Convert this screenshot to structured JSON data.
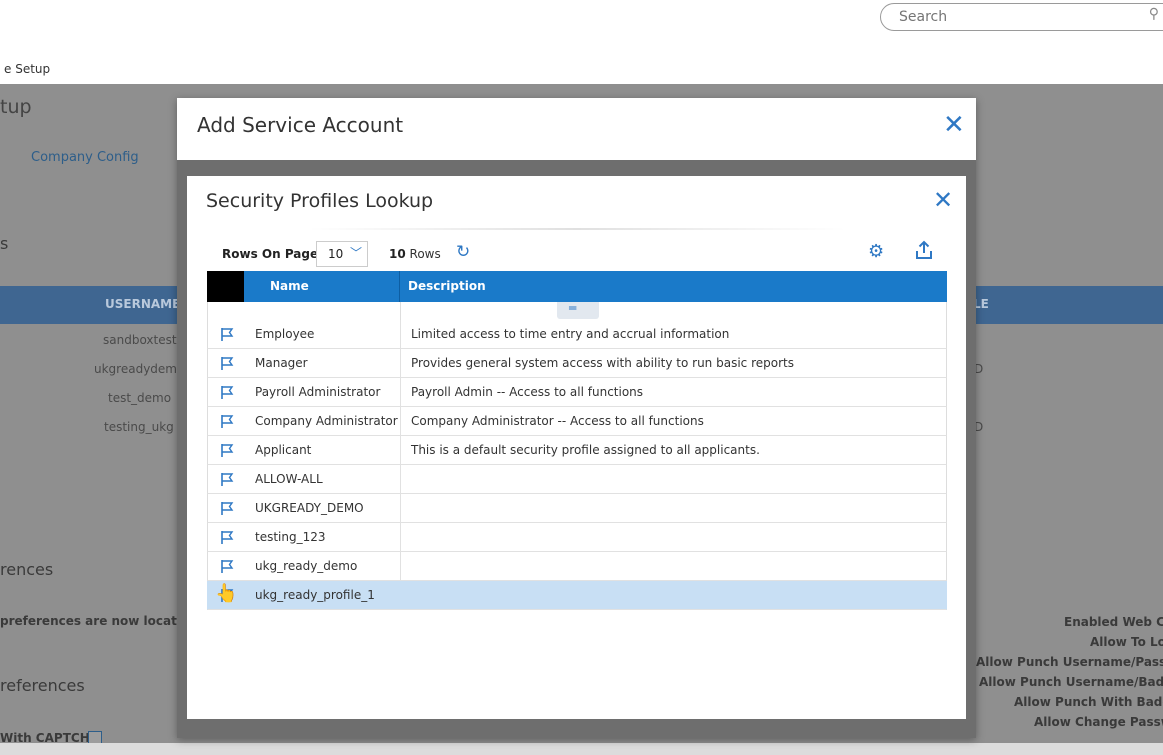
{
  "topbar": {
    "search_placeholder": "Search",
    "search_icon": "magnifier-icon",
    "breadcrumb": "e Setup"
  },
  "background": {
    "page_title": "tup",
    "tab_company_config": "Company Config",
    "section_s": "s",
    "table_header_username": "USERNAME",
    "table_header_right": "LE",
    "usernames": [
      "sandboxtest",
      "ukgreadydemo",
      "test_demo",
      "testing_ukg"
    ],
    "right_fragment_1": "D",
    "right_fragment_2": "D",
    "preferences_heading_1": "rences",
    "preferences_note": "preferences are now located v",
    "preferences_heading_2": "references",
    "captcha_label": "With CAPTCHA",
    "right_labels": [
      "Enabled Web Clo",
      "Allow To Log",
      "Allow Punch Username/Passwo",
      "Allow Punch Username/Badge",
      "Allow Punch With Badge",
      "Allow Change Passwo"
    ]
  },
  "outer_dialog": {
    "title": "Add Service Account",
    "close_icon": "close-x-icon"
  },
  "lookup_dialog": {
    "title": "Security Profiles Lookup",
    "close_icon": "close-x-icon",
    "toolbar": {
      "rows_on_page_label": "Rows On Page",
      "rows_on_page_value": "10",
      "rows_count_number": "10",
      "rows_count_label": "Rows",
      "refresh_icon": "refresh-icon",
      "settings_icon": "gear-icon",
      "export_icon": "upload-export-icon"
    },
    "columns": [
      "Name",
      "Description"
    ],
    "rows": [
      {
        "name": "Employee",
        "description": "Limited access to time entry and accrual information"
      },
      {
        "name": "Manager",
        "description": "Provides general system access with ability to run basic reports"
      },
      {
        "name": "Payroll Administrator",
        "description": "Payroll Admin -- Access to all functions"
      },
      {
        "name": "Company Administrator",
        "description": "Company Administrator -- Access to all functions"
      },
      {
        "name": "Applicant",
        "description": "This is a default security profile assigned to all applicants."
      },
      {
        "name": "ALLOW-ALL",
        "description": ""
      },
      {
        "name": "UKGREADY_DEMO",
        "description": ""
      },
      {
        "name": "testing_123",
        "description": ""
      },
      {
        "name": "ukg_ready_demo",
        "description": ""
      },
      {
        "name": "ukg_ready_profile_1",
        "description": ""
      }
    ],
    "selected_row_index": 9,
    "colors": {
      "header": "#1a7ac9",
      "accent": "#2f78c4",
      "selected_row": "#c8dff4"
    }
  }
}
